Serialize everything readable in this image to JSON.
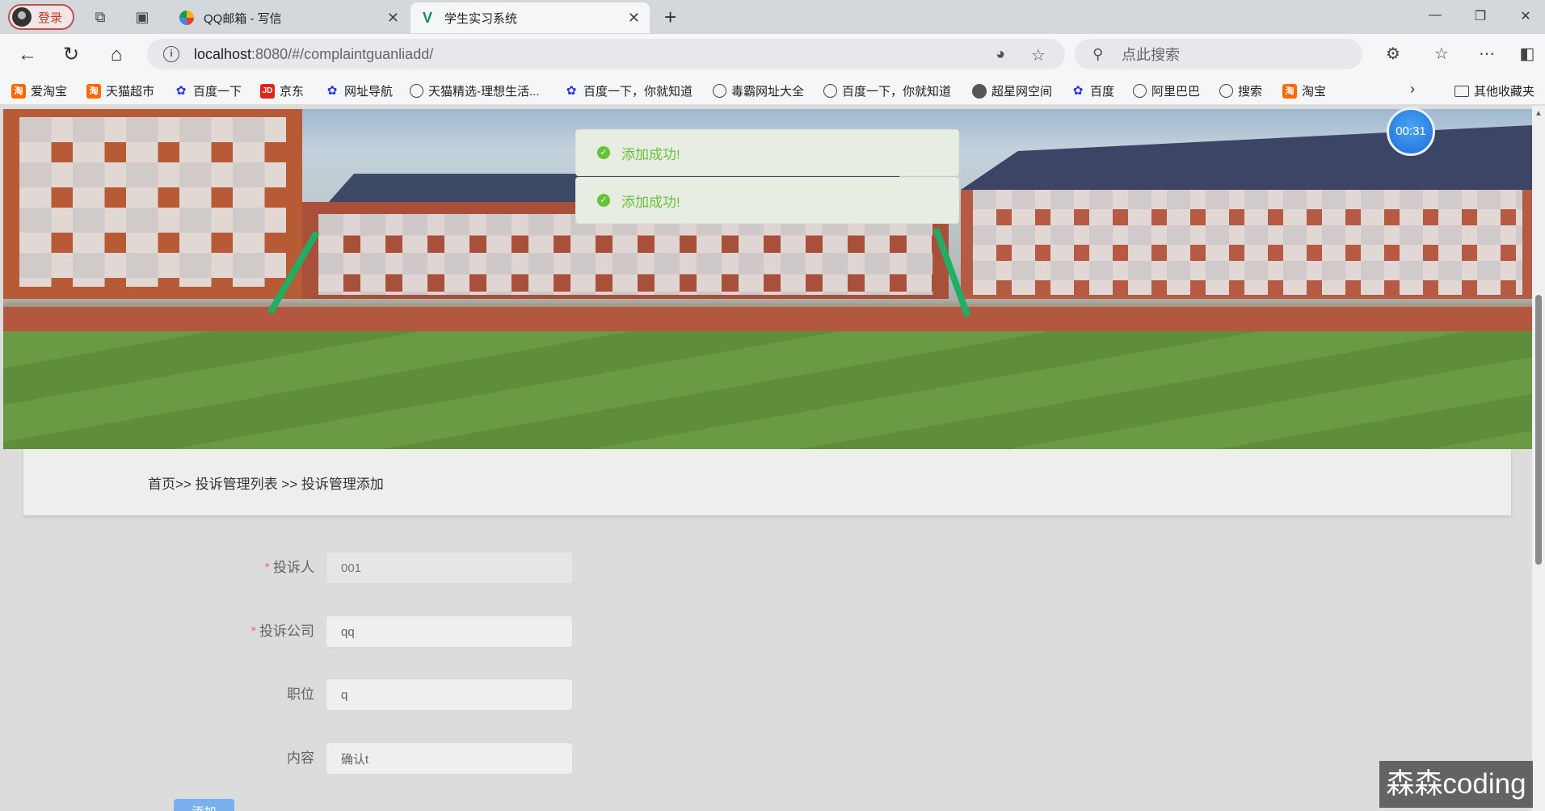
{
  "browser": {
    "login_label": "登录",
    "tabs": [
      {
        "title": "QQ邮箱 - 写信",
        "active": false
      },
      {
        "title": "学生实习系统",
        "active": true
      }
    ],
    "new_tab_label": "+",
    "url_host": "localhost",
    "url_path": ":8080/#/complaintguanliadd/",
    "search_placeholder": "点此搜索",
    "bookmarks": [
      {
        "label": "爱淘宝",
        "icon": "taobao-icon"
      },
      {
        "label": "天猫超市",
        "icon": "taobao-icon"
      },
      {
        "label": "百度一下",
        "icon": "baidu-icon"
      },
      {
        "label": "京东",
        "icon": "jd-icon"
      },
      {
        "label": "网址导航",
        "icon": "baidu-icon"
      },
      {
        "label": "天猫精选-理想生活...",
        "icon": "globe-icon"
      },
      {
        "label": "百度一下，你就知道",
        "icon": "baidu-icon"
      },
      {
        "label": "毒霸网址大全",
        "icon": "globe-icon"
      },
      {
        "label": "百度一下，你就知道",
        "icon": "globe-icon"
      },
      {
        "label": "超星网空间",
        "icon": "globe-icon"
      },
      {
        "label": "百度",
        "icon": "baidu-icon"
      },
      {
        "label": "阿里巴巴",
        "icon": "globe-icon"
      },
      {
        "label": "搜索",
        "icon": "globe-icon"
      },
      {
        "label": "淘宝",
        "icon": "taobao-icon"
      }
    ],
    "other_bookmarks_label": "其他收藏夹"
  },
  "page": {
    "toasts": [
      "添加成功!",
      "添加成功!"
    ],
    "timer": "00:31",
    "breadcrumb": "首页>> 投诉管理列表 >> 投诉管理添加",
    "form": {
      "fields": [
        {
          "label": "投诉人",
          "required": true,
          "value": "",
          "placeholder": "001",
          "disabled": true
        },
        {
          "label": "投诉公司",
          "required": true,
          "value": "qq",
          "placeholder": "",
          "disabled": false
        },
        {
          "label": "职位",
          "required": false,
          "value": "q",
          "placeholder": "",
          "disabled": false
        },
        {
          "label": "内容",
          "required": false,
          "value": "确认t",
          "placeholder": "",
          "disabled": false
        }
      ],
      "submit_label": "添加"
    },
    "watermark": "森森coding"
  },
  "colors": {
    "success": "#67c23a",
    "primary_button": "#79b0f0",
    "required_star": "#f56c6c"
  }
}
